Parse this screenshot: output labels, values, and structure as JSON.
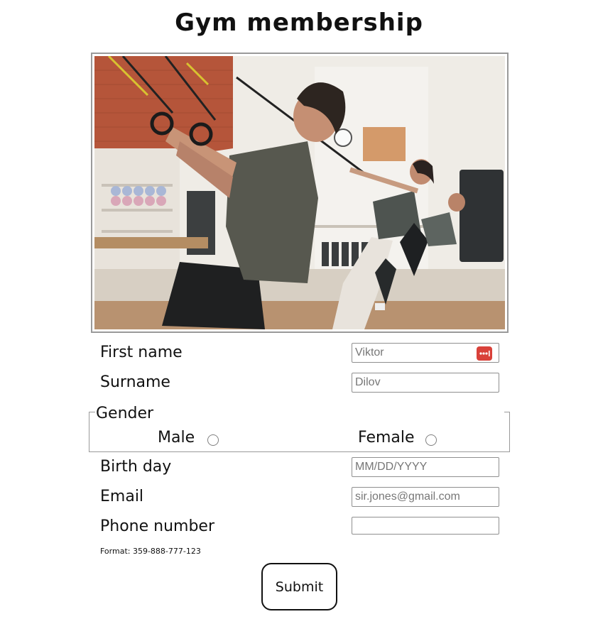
{
  "header": {
    "title": "Gym membership"
  },
  "hero_image": {
    "alt": "People training with suspension straps in a gym"
  },
  "form": {
    "first_name": {
      "label": "First name",
      "value": "Viktor"
    },
    "surname": {
      "label": "Surname",
      "value": "Dilov"
    },
    "gender": {
      "legend": "Gender",
      "options": [
        {
          "label": "Male",
          "checked": false
        },
        {
          "label": "Female",
          "checked": false
        }
      ]
    },
    "birthday": {
      "label": "Birth day",
      "placeholder": "MM/DD/YYYY"
    },
    "email": {
      "label": "Email",
      "placeholder": "sir.jones@gmail.com"
    },
    "phone": {
      "label": "Phone number",
      "value": "",
      "hint": "Format: 359-888-777-123"
    },
    "submit_label": "Submit"
  },
  "colors": {
    "password_manager_icon": "#d9413a",
    "border_gray": "#9a9a9a",
    "text": "#111111"
  },
  "icons": {
    "password_manager": "key-dots-icon"
  }
}
